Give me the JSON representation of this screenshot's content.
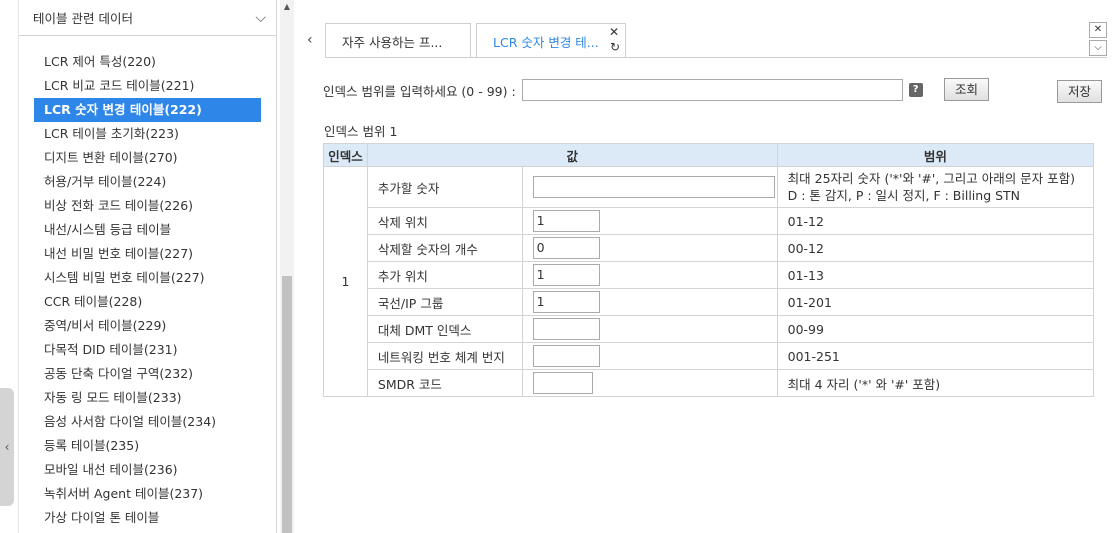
{
  "sidebar": {
    "header": "테이블 관련 데이터",
    "items": [
      {
        "label": "LCR 제어 특성(220)"
      },
      {
        "label": "LCR 비교 코드 테이블(221)"
      },
      {
        "label": "LCR 숫자 변경 테이블(222)",
        "active": true
      },
      {
        "label": "LCR 테이블 초기화(223)"
      },
      {
        "label": "디지트 변환 테이블(270)"
      },
      {
        "label": "허용/거부 테이블(224)"
      },
      {
        "label": "비상 전화 코드 테이블(226)"
      },
      {
        "label": "내선/시스템 등급 테이블"
      },
      {
        "label": "내선 비밀 번호 테이블(227)"
      },
      {
        "label": "시스템 비밀 번호 테이블(227)"
      },
      {
        "label": "CCR 테이블(228)"
      },
      {
        "label": "중역/비서 테이블(229)"
      },
      {
        "label": "다목적 DID 테이블(231)"
      },
      {
        "label": "공동 단축 다이얼 구역(232)"
      },
      {
        "label": "자동 링 모드 테이블(233)"
      },
      {
        "label": "음성 사서함 다이얼 테이블(234)"
      },
      {
        "label": "등록 테이블(235)"
      },
      {
        "label": "모바일 내선 테이블(236)"
      },
      {
        "label": "녹취서버 Agent 테이블(237)"
      },
      {
        "label": "가상 다이얼 톤 테이블"
      }
    ]
  },
  "tabs": [
    {
      "label": "자주 사용하는 프..."
    },
    {
      "label": "LCR 숫자 변경 테..."
    }
  ],
  "range": {
    "label": "인덱스 범위를 입력하세요 (0 - 99) :",
    "value": "",
    "help": "?",
    "lookup": "조회"
  },
  "save": "저장",
  "section_title": "인덱스 범위 1",
  "table": {
    "headers": {
      "index": "인덱스",
      "value": "값",
      "range": "범위"
    },
    "index": "1",
    "rows": [
      {
        "label": "추가할 숫자",
        "value": "",
        "range": "최대 25자리 숫자 ('*'와 '#', 그리고 아래의 문자 포함)",
        "range2": "D : 톤 감지, P : 일시 정지, F : Billing STN"
      },
      {
        "label": "삭제 위치",
        "value": "1",
        "range": "01-12"
      },
      {
        "label": "삭제할 숫자의 개수",
        "value": "0",
        "range": "00-12"
      },
      {
        "label": "추가 위치",
        "value": "1",
        "range": "01-13"
      },
      {
        "label": "국선/IP 그룹",
        "value": "1",
        "range": "01-201"
      },
      {
        "label": "대체 DMT 인덱스",
        "value": "",
        "range": "00-99"
      },
      {
        "label": "네트워킹 번호 체계 번지",
        "value": "",
        "range": "001-251"
      },
      {
        "label": "SMDR 코드",
        "value": "",
        "range": "최대 4 자리 ('*' 와 '#' 포함)"
      }
    ]
  }
}
